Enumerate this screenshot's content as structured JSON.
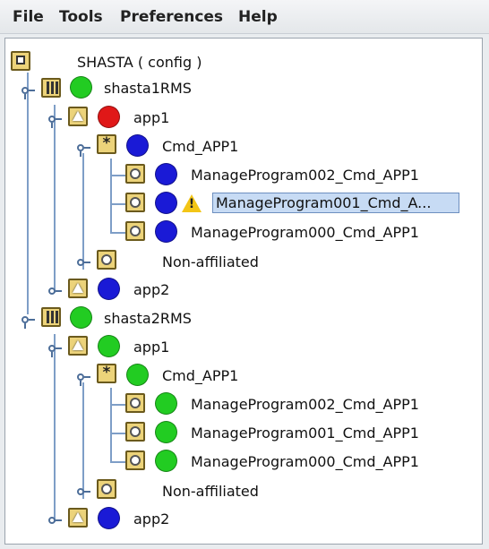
{
  "menubar": {
    "items": [
      "File",
      "Tools",
      "Preferences",
      "Help"
    ]
  },
  "colors": {
    "online": "#22cc22",
    "faulted": "#e01818",
    "offline": "#1a1ad6",
    "warning": "#f3c516",
    "selection": "#c7dbf4"
  },
  "tree": {
    "root": {
      "label": "SHASTA ( config )",
      "icon": "root-icon"
    },
    "nodes": [
      {
        "label": "shasta1RMS",
        "icon": "cluster-node-icon",
        "state": "online"
      },
      {
        "label": "app1",
        "icon": "application-icon",
        "state": "faulted"
      },
      {
        "label": "Cmd_APP1",
        "icon": "command-group-icon",
        "state": "offline"
      },
      {
        "label": "ManageProgram002_Cmd_APP1",
        "icon": "resource-icon",
        "state": "offline"
      },
      {
        "label": "ManageProgram001_Cmd_A...",
        "icon": "resource-icon",
        "state": "offline",
        "warning": true,
        "selected": true
      },
      {
        "label": "ManageProgram000_Cmd_APP1",
        "icon": "resource-icon",
        "state": "offline"
      },
      {
        "label": "Non-affiliated",
        "icon": "resource-icon"
      },
      {
        "label": "app2",
        "icon": "application-icon",
        "state": "offline"
      },
      {
        "label": "shasta2RMS",
        "icon": "cluster-node-icon",
        "state": "online"
      },
      {
        "label": "app1",
        "icon": "application-icon",
        "state": "online"
      },
      {
        "label": "Cmd_APP1",
        "icon": "command-group-icon",
        "state": "online"
      },
      {
        "label": "ManageProgram002_Cmd_APP1",
        "icon": "resource-icon",
        "state": "online"
      },
      {
        "label": "ManageProgram001_Cmd_APP1",
        "icon": "resource-icon",
        "state": "online"
      },
      {
        "label": "ManageProgram000_Cmd_APP1",
        "icon": "resource-icon",
        "state": "online"
      },
      {
        "label": "Non-affiliated",
        "icon": "resource-icon"
      },
      {
        "label": "app2",
        "icon": "application-icon",
        "state": "offline"
      }
    ]
  }
}
